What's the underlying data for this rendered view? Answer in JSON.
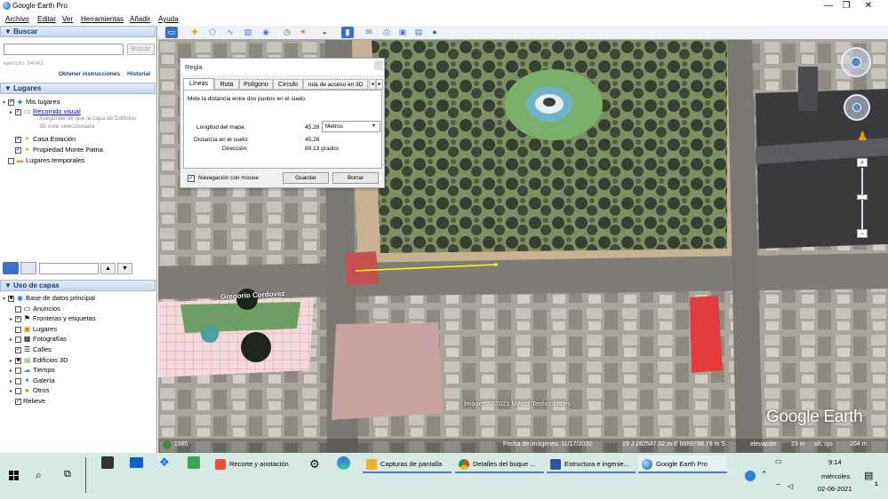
{
  "window": {
    "title": "Google Earth Pro",
    "minimize": "—",
    "maximize": "❐",
    "close": "✕"
  },
  "menu": [
    "Archivo",
    "Editar",
    "Ver",
    "Herramientas",
    "Añadir",
    "Ayuda"
  ],
  "search": {
    "header": "Buscar",
    "button": "Buscar",
    "example": "ejemplo: 94043",
    "link_instructions": "Obtener instrucciones",
    "link_history": "Historial"
  },
  "places": {
    "header": "Lugares",
    "my_places": "Mis lugares",
    "tour": "Recorrido visual",
    "tour_note_1": "Asegúrate de que la capa de Edificios",
    "tour_note_2": "3D esté seleccionada",
    "casa": "Casa Estación",
    "propiedad": "Propiedad Monte Patria",
    "temp": "Lugares temporales"
  },
  "layers": {
    "header": "Uso de capas",
    "primary": "Base de datos principal",
    "items": [
      "Anuncios",
      "Fronteras y etiquetas",
      "Lugares",
      "Fotografías",
      "Calles",
      "Edificios 3D",
      "Tiempo",
      "Galería",
      "Otros",
      "Relieve"
    ]
  },
  "ruler": {
    "title": "Regla",
    "tabs": [
      "Líneas",
      "Ruta",
      "Polígono",
      "Círculo",
      "ruta de acceso en 3D"
    ],
    "description": "Mide la distancia entre dos puntos en el suelo.",
    "map_length_label": "Longitud del mapa:",
    "map_length_value": "45.28",
    "unit": "Metros",
    "ground_length_label": "Distancia en el suelo:",
    "ground_length_value": "45.28",
    "heading_label": "Dirección:",
    "heading_value": "89.13 grados",
    "mouse_nav": "Navegación con mouse",
    "save": "Guardar",
    "clear": "Borrar"
  },
  "map": {
    "street_label": "Gregorio Cordovez",
    "copyright": "Imagen © 2021 Maxar Technologies",
    "watermark": "Google Earth",
    "year": "1985",
    "imagery_date": "Fecha de imágenes: 11/17/2020",
    "coords": "19 J 282547.02 m E 6689788.79 m S",
    "elevation": "elevación",
    "elev_val": "23 m",
    "eye_label": "alt. ojo",
    "eye_val": "204 m"
  },
  "taskbar": {
    "apps": [
      "Recorte y anotación",
      "Capturas de pantalla",
      "Detalles del buque ...",
      "Estructura e ingenie...",
      "Google Earth Pro"
    ],
    "time": "9:14",
    "day": "miércoles",
    "date": "02-06-2021",
    "notif_count": "1"
  },
  "colors": {
    "accent": "#1a3e78",
    "ruler_line": "#ffff00",
    "taskbar": "#d6e9e4"
  }
}
